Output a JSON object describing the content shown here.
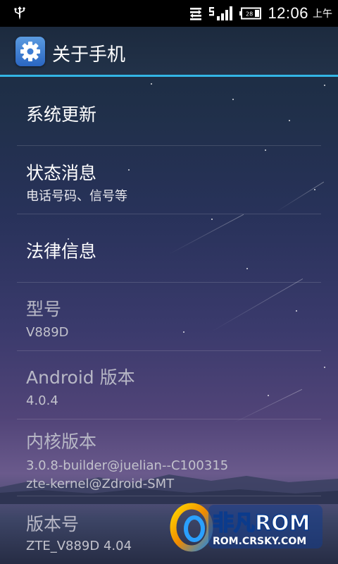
{
  "status_bar": {
    "time": "12:06",
    "ampm": "上午",
    "battery_level": "28",
    "icons": [
      "usb-icon",
      "sync-icon",
      "signal-strength-icon",
      "battery-icon"
    ]
  },
  "action_bar": {
    "title": "关于手机",
    "icon": "settings-gear-icon",
    "accent": "#33b5e5"
  },
  "items": [
    {
      "title": "系统更新",
      "summary": "",
      "enabled": true
    },
    {
      "title": "状态消息",
      "summary": "电话号码、信号等",
      "enabled": true
    },
    {
      "title": "法律信息",
      "summary": "",
      "enabled": true
    },
    {
      "title": "型号",
      "summary": "V889D",
      "enabled": false
    },
    {
      "title": "Android 版本",
      "summary": "4.0.4",
      "enabled": false
    },
    {
      "title": "内核版本",
      "summary": "3.0.8-builder@juelian--C100315\nzte-kernel@Zdroid-SMT",
      "enabled": false
    },
    {
      "title": "版本号",
      "summary": "ZTE_V889D 4.04",
      "enabled": false
    }
  ],
  "watermark": {
    "brand": "非凡ROM",
    "site": "ROM.CRSKY.COM"
  }
}
